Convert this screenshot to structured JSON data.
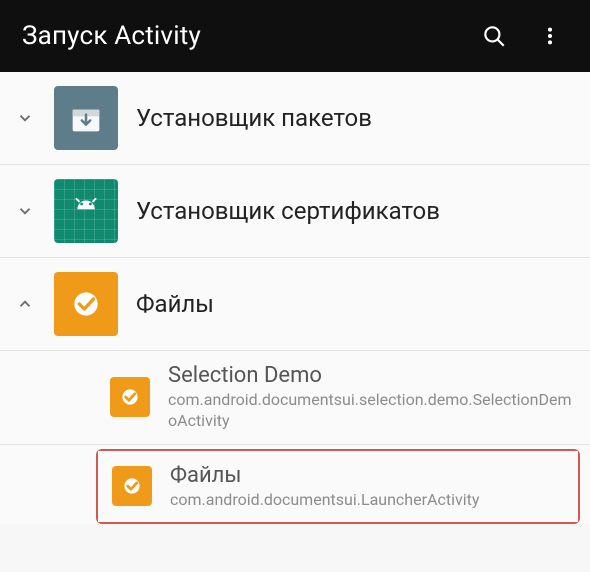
{
  "appbar": {
    "title": "Запуск Activity",
    "search_icon": "search-icon",
    "overflow_icon": "more-vert-icon"
  },
  "apps": [
    {
      "id": "pkginstaller",
      "label": "Установщик пакетов",
      "expanded": false,
      "icon": "package-installer-icon"
    },
    {
      "id": "certinstaller",
      "label": "Установщик сертификатов",
      "expanded": false,
      "icon": "cert-installer-icon"
    },
    {
      "id": "files",
      "label": "Файлы",
      "expanded": true,
      "icon": "files-icon",
      "activities": [
        {
          "title": "Selection Demo",
          "package": "com.android.documentsui.selection.demo.SelectionDemoActivity",
          "highlighted": false
        },
        {
          "title": "Файлы",
          "package": "com.android.documentsui.LauncherActivity",
          "highlighted": true
        }
      ]
    }
  ]
}
